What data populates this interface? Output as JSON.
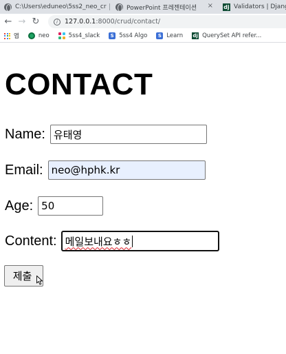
{
  "browser": {
    "tabs": [
      {
        "title": "C:\\Users\\eduneo\\5ss2_neo_cr",
        "icon": "globe-icon"
      },
      {
        "title": "PowerPoint 프레젠테이션",
        "icon": "globe-icon"
      },
      {
        "title": "Validators | Django d",
        "icon": "django-icon"
      }
    ],
    "url_host": "127.0.0.1",
    "url_path": ":8000/crud/contact/",
    "bookmarks": [
      {
        "label": "앱",
        "icon": "apps-grid-icon"
      },
      {
        "label": "neo",
        "icon": "neo-icon"
      },
      {
        "label": "5ss4_slack",
        "icon": "slack-icon"
      },
      {
        "label": "5ss4 Algo",
        "icon": "s-icon"
      },
      {
        "label": "Learn",
        "icon": "s-icon"
      },
      {
        "label": "QuerySet API refer...",
        "icon": "django-icon"
      }
    ]
  },
  "page": {
    "title": "CONTACT",
    "fields": {
      "name": {
        "label": "Name:",
        "value": "유태영"
      },
      "email": {
        "label": "Email:",
        "value": "neo@hphk.kr"
      },
      "age": {
        "label": "Age:",
        "value": "50"
      },
      "content": {
        "label": "Content:",
        "value": "메일보내요ㅎㅎ"
      }
    },
    "submit_label": "제출"
  }
}
